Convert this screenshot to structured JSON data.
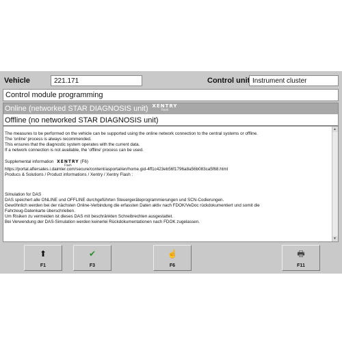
{
  "header": {
    "vehicle_label": "Vehicle",
    "vehicle_value": "221.171",
    "control_unit_label": "Control unit",
    "control_unit_value": "Instrument cluster"
  },
  "section_title": "Control module programming",
  "options": [
    {
      "label": "Online (networked STAR DIAGNOSIS unit)",
      "selected": true,
      "logo": "XENTRY",
      "logo_sub": "Flash"
    },
    {
      "label": "Offline (no networked STAR DIAGNOSIS unit)",
      "selected": false
    }
  ],
  "info": {
    "lines": [
      "The measures to be performed on the vehicle can be supported using the online network connection to the central systems or offline.",
      "The 'online' process is always recommended.",
      "This ensures that the diagnostic system operates with the current data.",
      "If a network connection is not available, the 'offline' process can be used."
    ],
    "supplemental_prefix": "Supplemental information",
    "supplemental_logo": "XENTRY",
    "supplemental_logo_sub": "Flash",
    "supplemental_suffix": "(F6)",
    "url": "https://portal.aftersales.i.daimler.com/secure/content/asportal/en/home.gid-4ff1c423eb56f1796a8a56b083ca5f68.html",
    "path": "Producs & Solutions / Product informations / Xentry / Xentry Flash :",
    "german": [
      "Simulation for DAS",
      "DAS speichert alle ONLINE und OFFLINE durchgeführten Steuergeräteprogrammierungen und SCN-Codierungen.",
      "Gewöhnlich werden bei der nächsten Online-Verbindung die erfassten Daten aktiv nach FDOK/VeDoc rückdokumentiert und somit die",
      "Fahrzeug-Datenkarte überschrieben.",
      "Um Risiken zu vermeiden ist dieses DAS mit beschränkten Schreibrechten ausgestattet.",
      "Bei Verwendung der DAS-Simulation werden keinerlei Rückdokumentationen nach FDOK zugelassen."
    ]
  },
  "fkeys": [
    {
      "key": "F1",
      "icon": "up-arrow-icon",
      "glyph": "⬆",
      "color": "#111111"
    },
    {
      "key": "F3",
      "icon": "checkmark-icon",
      "glyph": "✔",
      "color": "#2e8b2e"
    },
    {
      "key": "F6",
      "icon": "info-hand-icon",
      "glyph": "☝",
      "color": "#c8a200"
    },
    {
      "key": "F11",
      "icon": "printer-icon",
      "glyph": "🖶",
      "color": "#444444"
    }
  ]
}
